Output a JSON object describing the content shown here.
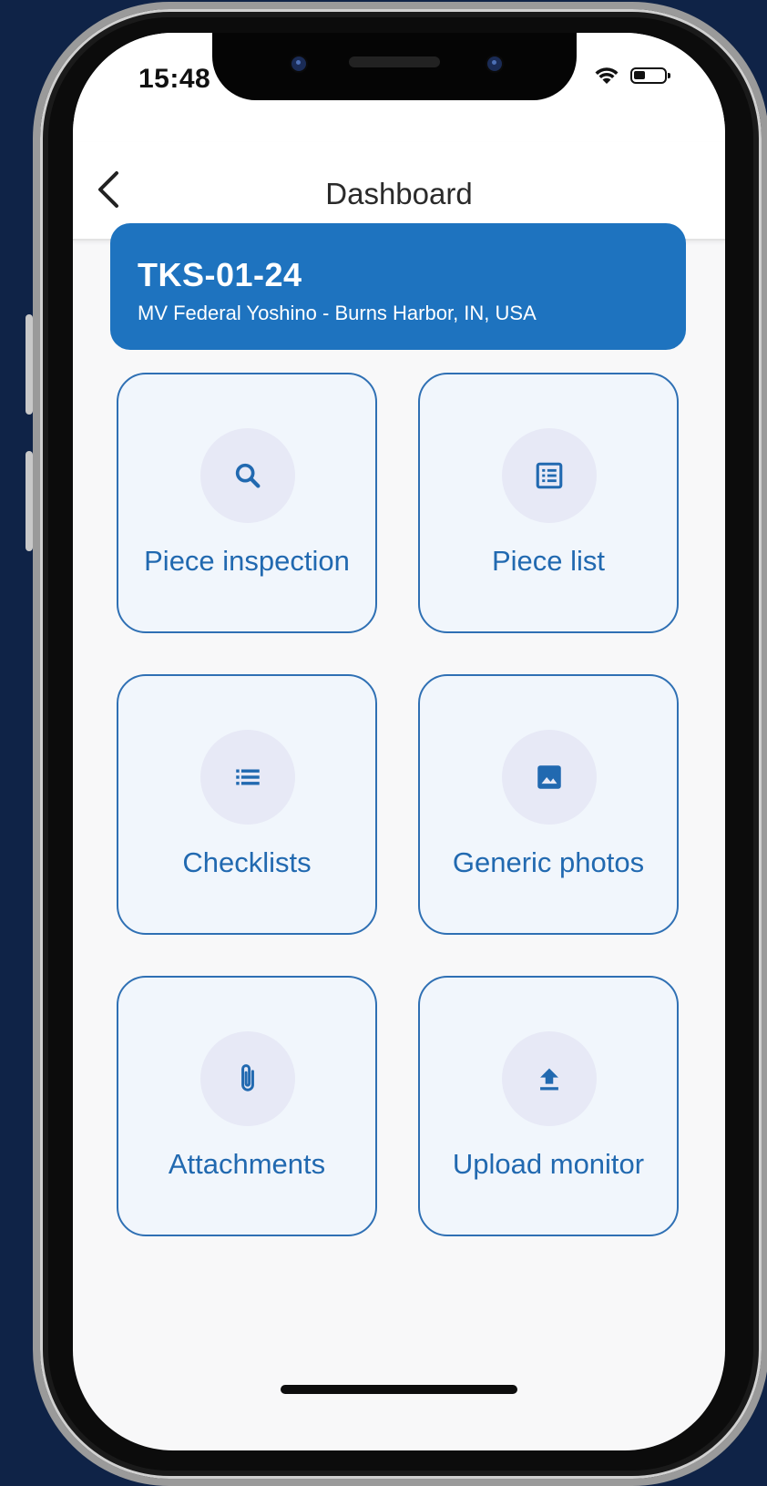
{
  "status": {
    "time": "15:48"
  },
  "header": {
    "title": "Dashboard"
  },
  "job": {
    "code": "TKS-01-24",
    "subtitle": "MV Federal Yoshino - Burns Harbor, IN, USA"
  },
  "tiles": [
    {
      "label": "Piece inspection",
      "icon": "search-icon"
    },
    {
      "label": "Piece list",
      "icon": "list-alt-icon"
    },
    {
      "label": "Checklists",
      "icon": "list-icon"
    },
    {
      "label": "Generic photos",
      "icon": "image-icon"
    },
    {
      "label": "Attachments",
      "icon": "paperclip-icon"
    },
    {
      "label": "Upload monitor",
      "icon": "upload-icon"
    }
  ],
  "colors": {
    "accent": "#1e73bf",
    "tile_bg": "#f1f6fc",
    "tile_border": "#2f70b4",
    "icon_circle": "#e7e9f6",
    "background": "#0f2347"
  }
}
